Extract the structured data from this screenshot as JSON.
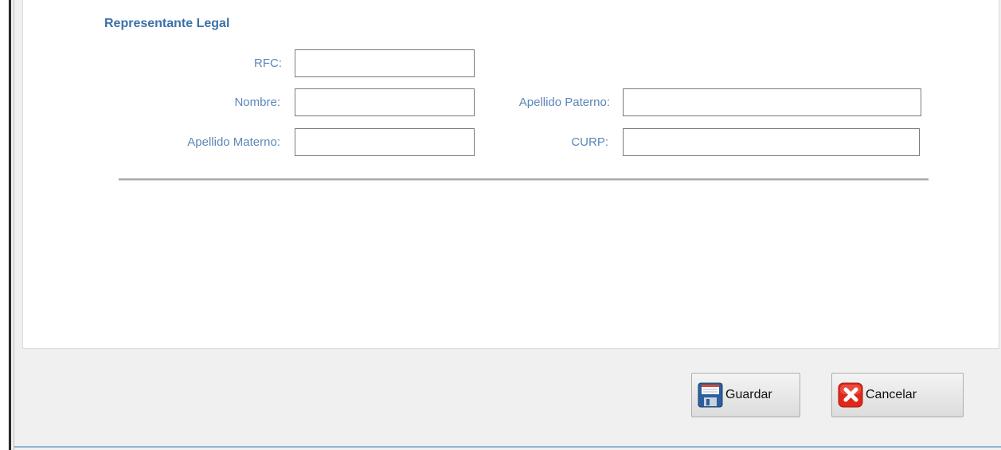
{
  "section": {
    "title": "Representante Legal"
  },
  "fields": {
    "rfc": {
      "label": "RFC:",
      "value": ""
    },
    "nombre": {
      "label": "Nombre:",
      "value": ""
    },
    "apellido_paterno": {
      "label": "Apellido Paterno:",
      "value": ""
    },
    "apellido_materno": {
      "label": "Apellido Materno:",
      "value": ""
    },
    "curp": {
      "label": "CURP:",
      "value": ""
    }
  },
  "buttons": {
    "save": {
      "label": "Guardar",
      "icon": "floppy-disk-icon"
    },
    "cancel": {
      "label": "Cancelar",
      "icon": "red-x-icon"
    }
  },
  "colors": {
    "title": "#3b71a9",
    "label": "#5b87b8",
    "cancel_red": "#e0281a",
    "save_blue": "#2d5f9e"
  }
}
